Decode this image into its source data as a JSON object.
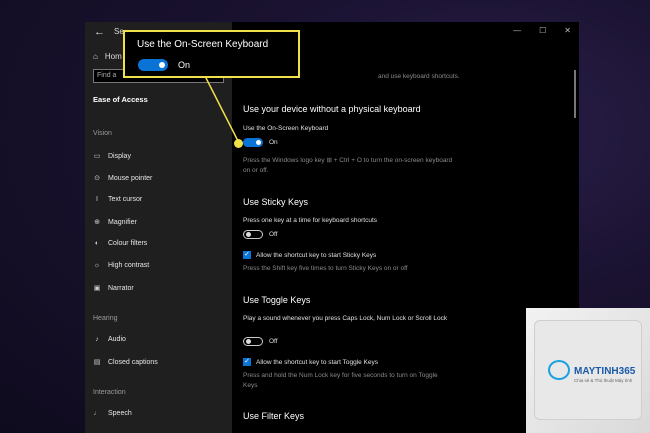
{
  "window": {
    "title": "Se",
    "controls": [
      "—",
      "☐",
      "✕"
    ]
  },
  "sidebar": {
    "back": "←",
    "home": "Hom",
    "search_placeholder": "Find a",
    "section": "Ease of Access",
    "groups": [
      {
        "title": "Vision",
        "items": [
          "Display",
          "Mouse pointer",
          "Text cursor",
          "Magnifier",
          "Colour filters",
          "High contrast",
          "Narrator"
        ]
      },
      {
        "title": "Hearing",
        "items": [
          "Audio",
          "Closed captions"
        ]
      },
      {
        "title": "Interaction",
        "items": [
          "Speech"
        ]
      }
    ]
  },
  "main": {
    "top_text": "and use keyboard shortcuts.",
    "physical": {
      "title": "Use your device without a physical keyboard",
      "osk_label": "Use the On-Screen Keyboard",
      "osk_state": "On",
      "osk_desc": "Press the Windows logo key ⊞ + Ctrl + O to turn the on-screen keyboard on or off."
    },
    "sticky": {
      "title": "Use Sticky Keys",
      "label": "Press one key at a time for keyboard shortcuts",
      "state": "Off",
      "check_label": "Allow the shortcut key to start Sticky Keys",
      "desc": "Press the Shift key five times to turn Sticky Keys on or off"
    },
    "toggle_keys": {
      "title": "Use Toggle Keys",
      "label": "Play a sound whenever you press Caps Lock, Num Lock or Scroll Lock",
      "state": "Off",
      "check_label": "Allow the shortcut key to start Toggle Keys",
      "desc": "Press and hold the Num Lock key for five seconds to turn on Toggle Keys"
    },
    "filter": {
      "title": "Use Filter Keys"
    }
  },
  "callout": {
    "title": "Use the On-Screen Keyboard",
    "state": "On",
    "border_color": "#f0e04a"
  },
  "brand": {
    "name": "MAYTINH365",
    "tagline": "Chia sẻ & Thủ thuật Máy tính"
  },
  "colors": {
    "accent": "#0a74d6",
    "highlight": "#f0e04a"
  }
}
